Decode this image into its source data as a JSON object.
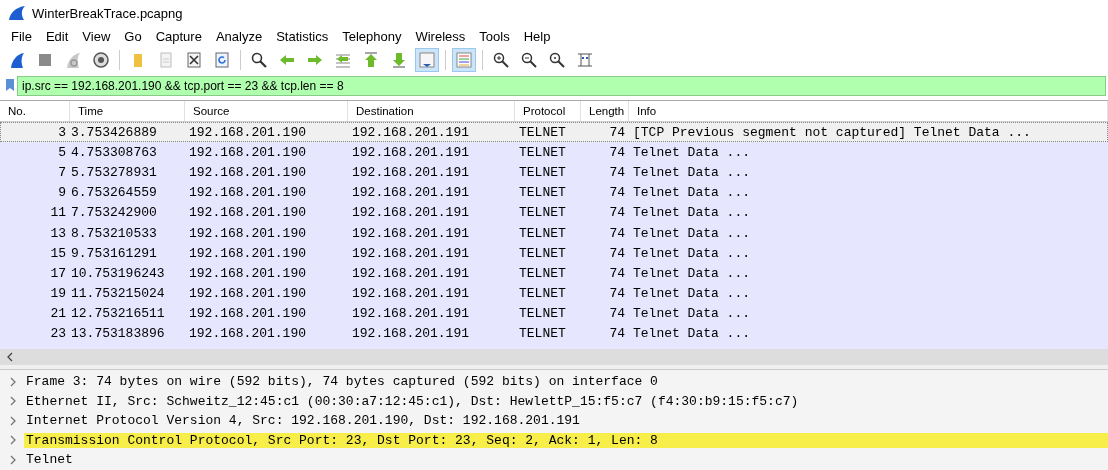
{
  "window": {
    "title": "WinterBreakTrace.pcapng"
  },
  "menu": [
    "File",
    "Edit",
    "View",
    "Go",
    "Capture",
    "Analyze",
    "Statistics",
    "Telephony",
    "Wireless",
    "Tools",
    "Help"
  ],
  "toolbar": [
    {
      "kind": "start",
      "pressed": false
    },
    {
      "kind": "stop",
      "pressed": false
    },
    {
      "kind": "restart",
      "pressed": false
    },
    {
      "kind": "options",
      "pressed": false
    },
    {
      "kind": "separator"
    },
    {
      "kind": "open",
      "pressed": false
    },
    {
      "kind": "save",
      "pressed": false
    },
    {
      "kind": "close",
      "pressed": false
    },
    {
      "kind": "reload",
      "pressed": false
    },
    {
      "kind": "separator"
    },
    {
      "kind": "find",
      "pressed": false
    },
    {
      "kind": "back",
      "pressed": false
    },
    {
      "kind": "forward",
      "pressed": false
    },
    {
      "kind": "goto",
      "pressed": false
    },
    {
      "kind": "first",
      "pressed": false
    },
    {
      "kind": "last",
      "pressed": false
    },
    {
      "kind": "autoscroll",
      "pressed": true
    },
    {
      "kind": "separator"
    },
    {
      "kind": "colorize",
      "pressed": true
    },
    {
      "kind": "separator"
    },
    {
      "kind": "zoom_in",
      "pressed": false
    },
    {
      "kind": "zoom_out",
      "pressed": false
    },
    {
      "kind": "zoom_normal",
      "pressed": false
    },
    {
      "kind": "resize",
      "pressed": false
    }
  ],
  "filter": {
    "value": "ip.src == 192.168.201.190 && tcp.port == 23 && tcp.len == 8"
  },
  "packet_list": {
    "columns": [
      "No.",
      "Time",
      "Source",
      "Destination",
      "Protocol",
      "Length",
      "Info"
    ],
    "rows": [
      {
        "no": "3",
        "time": "3.753426889",
        "source": "192.168.201.190",
        "destination": "192.168.201.191",
        "protocol": "TELNET",
        "length": "74",
        "info": "[TCP Previous segment not captured] Telnet Data ...",
        "selected": true
      },
      {
        "no": "5",
        "time": "4.753308763",
        "source": "192.168.201.190",
        "destination": "192.168.201.191",
        "protocol": "TELNET",
        "length": "74",
        "info": "Telnet Data ...",
        "selected": false
      },
      {
        "no": "7",
        "time": "5.753278931",
        "source": "192.168.201.190",
        "destination": "192.168.201.191",
        "protocol": "TELNET",
        "length": "74",
        "info": "Telnet Data ...",
        "selected": false
      },
      {
        "no": "9",
        "time": "6.753264559",
        "source": "192.168.201.190",
        "destination": "192.168.201.191",
        "protocol": "TELNET",
        "length": "74",
        "info": "Telnet Data ...",
        "selected": false
      },
      {
        "no": "11",
        "time": "7.753242900",
        "source": "192.168.201.190",
        "destination": "192.168.201.191",
        "protocol": "TELNET",
        "length": "74",
        "info": "Telnet Data ...",
        "selected": false
      },
      {
        "no": "13",
        "time": "8.753210533",
        "source": "192.168.201.190",
        "destination": "192.168.201.191",
        "protocol": "TELNET",
        "length": "74",
        "info": "Telnet Data ...",
        "selected": false
      },
      {
        "no": "15",
        "time": "9.753161291",
        "source": "192.168.201.190",
        "destination": "192.168.201.191",
        "protocol": "TELNET",
        "length": "74",
        "info": "Telnet Data ...",
        "selected": false
      },
      {
        "no": "17",
        "time": "10.753196243",
        "source": "192.168.201.190",
        "destination": "192.168.201.191",
        "protocol": "TELNET",
        "length": "74",
        "info": "Telnet Data ...",
        "selected": false
      },
      {
        "no": "19",
        "time": "11.753215024",
        "source": "192.168.201.190",
        "destination": "192.168.201.191",
        "protocol": "TELNET",
        "length": "74",
        "info": "Telnet Data ...",
        "selected": false
      },
      {
        "no": "21",
        "time": "12.753216511",
        "source": "192.168.201.190",
        "destination": "192.168.201.191",
        "protocol": "TELNET",
        "length": "74",
        "info": "Telnet Data ...",
        "selected": false
      },
      {
        "no": "23",
        "time": "13.753183896",
        "source": "192.168.201.190",
        "destination": "192.168.201.191",
        "protocol": "TELNET",
        "length": "74",
        "info": "Telnet Data ...",
        "selected": false
      }
    ]
  },
  "details": [
    {
      "text": "Frame 3: 74 bytes on wire (592 bits), 74 bytes captured (592 bits) on interface 0",
      "expanded": false,
      "selected": false
    },
    {
      "text": "Ethernet II, Src: Schweitz_12:45:c1 (00:30:a7:12:45:c1), Dst: HewlettP_15:f5:c7 (f4:30:b9:15:f5:c7)",
      "expanded": false,
      "selected": false
    },
    {
      "text": "Internet Protocol Version 4, Src: 192.168.201.190, Dst: 192.168.201.191",
      "expanded": false,
      "selected": false
    },
    {
      "text": "Transmission Control Protocol, Src Port: 23, Dst Port: 23, Seq: 2, Ack: 1, Len: 8",
      "expanded": false,
      "selected": true
    },
    {
      "text": "Telnet",
      "expanded": false,
      "selected": false
    }
  ]
}
